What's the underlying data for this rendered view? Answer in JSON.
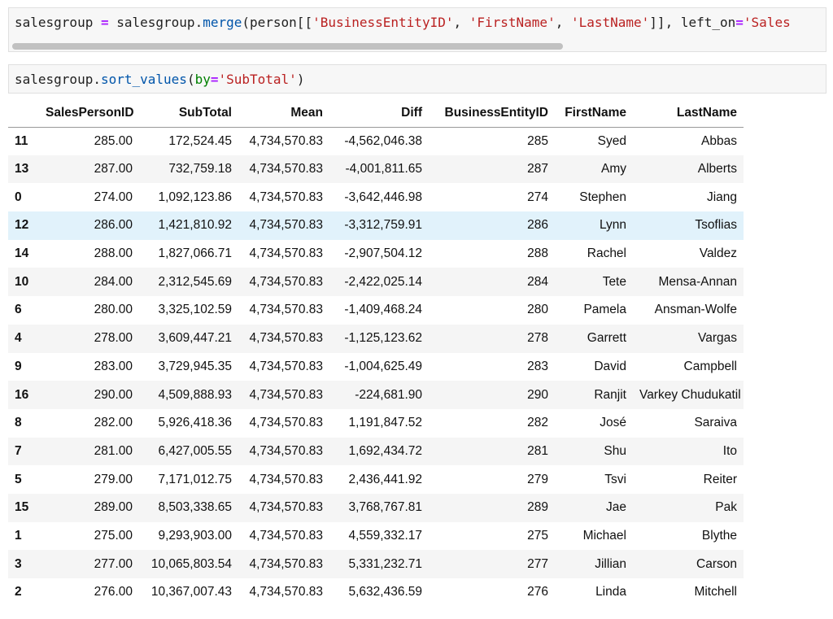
{
  "cells": [
    {
      "tokens": [
        {
          "t": "salesgroup",
          "c": "var"
        },
        {
          "t": " = ",
          "c": "op"
        },
        {
          "t": "salesgroup.",
          "c": "var"
        },
        {
          "t": "merge",
          "c": "fn"
        },
        {
          "t": "(person[[",
          "c": "p"
        },
        {
          "t": "'BusinessEntityID'",
          "c": "str"
        },
        {
          "t": ", ",
          "c": "p"
        },
        {
          "t": "'FirstName'",
          "c": "str"
        },
        {
          "t": ", ",
          "c": "p"
        },
        {
          "t": "'LastName'",
          "c": "str"
        },
        {
          "t": "]], left_on",
          "c": "p"
        },
        {
          "t": "=",
          "c": "op"
        },
        {
          "t": "'Sales",
          "c": "str"
        }
      ]
    },
    {
      "tokens": [
        {
          "t": "salesgroup.",
          "c": "var"
        },
        {
          "t": "sort_values",
          "c": "fn"
        },
        {
          "t": "(",
          "c": "p"
        },
        {
          "t": "by",
          "c": "kw"
        },
        {
          "t": "=",
          "c": "op"
        },
        {
          "t": "'SubTotal'",
          "c": "str"
        },
        {
          "t": ")",
          "c": "p"
        }
      ]
    }
  ],
  "table": {
    "columns": [
      "",
      "SalesPersonID",
      "SubTotal",
      "Mean",
      "Diff",
      "BusinessEntityID",
      "FirstName",
      "LastName"
    ],
    "highlighted_row": 3,
    "rows": [
      [
        "11",
        "285.00",
        "172,524.45",
        "4,734,570.83",
        "-4,562,046.38",
        "285",
        "Syed",
        "Abbas"
      ],
      [
        "13",
        "287.00",
        "732,759.18",
        "4,734,570.83",
        "-4,001,811.65",
        "287",
        "Amy",
        "Alberts"
      ],
      [
        "0",
        "274.00",
        "1,092,123.86",
        "4,734,570.83",
        "-3,642,446.98",
        "274",
        "Stephen",
        "Jiang"
      ],
      [
        "12",
        "286.00",
        "1,421,810.92",
        "4,734,570.83",
        "-3,312,759.91",
        "286",
        "Lynn",
        "Tsoflias"
      ],
      [
        "14",
        "288.00",
        "1,827,066.71",
        "4,734,570.83",
        "-2,907,504.12",
        "288",
        "Rachel",
        "Valdez"
      ],
      [
        "10",
        "284.00",
        "2,312,545.69",
        "4,734,570.83",
        "-2,422,025.14",
        "284",
        "Tete",
        "Mensa-Annan"
      ],
      [
        "6",
        "280.00",
        "3,325,102.59",
        "4,734,570.83",
        "-1,409,468.24",
        "280",
        "Pamela",
        "Ansman-Wolfe"
      ],
      [
        "4",
        "278.00",
        "3,609,447.21",
        "4,734,570.83",
        "-1,125,123.62",
        "278",
        "Garrett",
        "Vargas"
      ],
      [
        "9",
        "283.00",
        "3,729,945.35",
        "4,734,570.83",
        "-1,004,625.49",
        "283",
        "David",
        "Campbell"
      ],
      [
        "16",
        "290.00",
        "4,509,888.93",
        "4,734,570.83",
        "-224,681.90",
        "290",
        "Ranjit",
        "Varkey Chudukatil"
      ],
      [
        "8",
        "282.00",
        "5,926,418.36",
        "4,734,570.83",
        "1,191,847.52",
        "282",
        "José",
        "Saraiva"
      ],
      [
        "7",
        "281.00",
        "6,427,005.55",
        "4,734,570.83",
        "1,692,434.72",
        "281",
        "Shu",
        "Ito"
      ],
      [
        "5",
        "279.00",
        "7,171,012.75",
        "4,734,570.83",
        "2,436,441.92",
        "279",
        "Tsvi",
        "Reiter"
      ],
      [
        "15",
        "289.00",
        "8,503,338.65",
        "4,734,570.83",
        "3,768,767.81",
        "289",
        "Jae",
        "Pak"
      ],
      [
        "1",
        "275.00",
        "9,293,903.00",
        "4,734,570.83",
        "4,559,332.17",
        "275",
        "Michael",
        "Blythe"
      ],
      [
        "3",
        "277.00",
        "10,065,803.54",
        "4,734,570.83",
        "5,331,232.71",
        "277",
        "Jillian",
        "Carson"
      ],
      [
        "2",
        "276.00",
        "10,367,007.43",
        "4,734,570.83",
        "5,632,436.59",
        "276",
        "Linda",
        "Mitchell"
      ]
    ]
  }
}
